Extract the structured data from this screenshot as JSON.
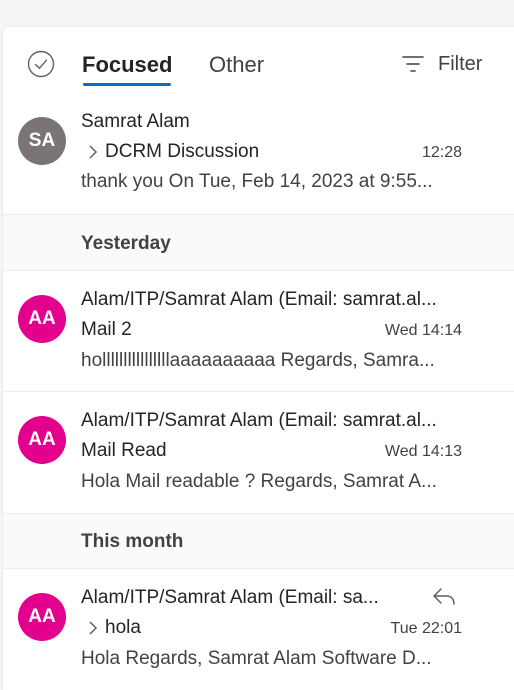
{
  "tabs": {
    "focused": "Focused",
    "other": "Other",
    "filter": "Filter"
  },
  "groups": {
    "yesterday": "Yesterday",
    "this_month": "This month"
  },
  "messages": [
    {
      "initials": "SA",
      "avatar_color": "#7a7574",
      "sender": "Samrat Alam",
      "subject": "DCRM Discussion",
      "time": "12:28",
      "preview": "thank you On Tue, Feb 14, 2023 at 9:55..."
    },
    {
      "initials": "AA",
      "avatar_color": "#e3008c",
      "sender": "Alam/ITP/Samrat Alam (Email: samrat.al...",
      "subject": "Mail 2",
      "time": "Wed 14:14",
      "preview": "hollllllllllllllllaaaaaaaaaa Regards, Samra..."
    },
    {
      "initials": "AA",
      "avatar_color": "#e3008c",
      "sender": "Alam/ITP/Samrat Alam (Email: samrat.al...",
      "subject": "Mail Read",
      "time": "Wed 14:13",
      "preview": "Hola Mail readable ? Regards, Samrat A..."
    },
    {
      "initials": "AA",
      "avatar_color": "#e3008c",
      "sender": "Alam/ITP/Samrat Alam (Email: sa...",
      "subject": "hola",
      "time": "Tue 22:01",
      "preview": "Hola Regards, Samrat Alam Software D..."
    }
  ],
  "colors": {
    "accent": "#0f6cbd"
  }
}
